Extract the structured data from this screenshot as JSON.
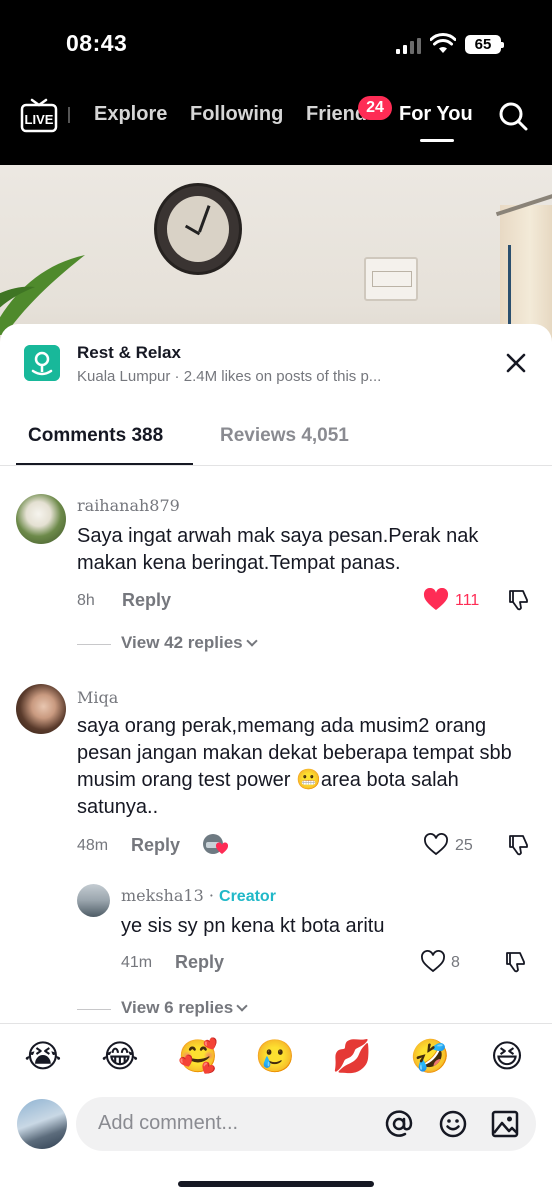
{
  "status_bar": {
    "time": "08:43",
    "battery": "65"
  },
  "top_nav": {
    "live_label": "LIVE",
    "tabs": [
      "Explore",
      "Following",
      "Friends",
      "For You"
    ],
    "active_tab": "For You",
    "friends_badge": "24"
  },
  "place": {
    "title": "Rest & Relax",
    "subtitle": "Kuala Lumpur · 2.4M likes on posts of this p..."
  },
  "sheet_tabs": {
    "comments": "Comments 388",
    "reviews": "Reviews 4,051"
  },
  "comments": [
    {
      "username": "raihanah879",
      "text": "Saya ingat arwah mak saya pesan.Perak nak makan kena beringat.Tempat panas.",
      "time": "8h",
      "reply_label": "Reply",
      "likes": "111",
      "liked": true,
      "view_replies": "View 42 replies"
    },
    {
      "username": "Miqa",
      "text": "saya orang perak,memang ada musim2 orang pesan jangan makan dekat beberapa tempat sbb musim orang test power 😬area bota salah satunya..",
      "time": "48m",
      "reply_label": "Reply",
      "likes": "25",
      "liked": false,
      "replies": [
        {
          "username": "meksha13",
          "tag": "Creator",
          "text": "ye sis sy pn kena kt bota aritu",
          "time": "41m",
          "reply_label": "Reply",
          "likes": "8"
        }
      ],
      "view_replies": "View 6 replies"
    }
  ],
  "emoji_bar": [
    "😭",
    "😂",
    "🥰",
    "🥲",
    "💋",
    "🤣",
    "😆"
  ],
  "composer": {
    "placeholder": "Add comment..."
  },
  "colors": {
    "accent_red": "#fe2c55",
    "creator_teal": "#20b8c8",
    "place_icon": "#18b89a"
  }
}
